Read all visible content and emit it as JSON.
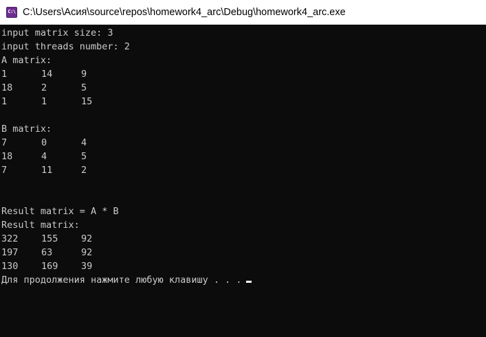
{
  "window": {
    "title": "C:\\Users\\Асия\\source\\repos\\homework4_arc\\Debug\\homework4_arc.exe",
    "icon": "C:\\"
  },
  "console": {
    "size_prompt": "input matrix size: 3",
    "threads_prompt": "input threads number: 2",
    "a_header": "A matrix:",
    "a_rows": [
      [
        "1",
        "14",
        "9"
      ],
      [
        "18",
        "2",
        "5"
      ],
      [
        "1",
        "1",
        "15"
      ]
    ],
    "b_header": "B matrix:",
    "b_rows": [
      [
        "7",
        "0",
        "4"
      ],
      [
        "18",
        "4",
        "5"
      ],
      [
        "7",
        "11",
        "2"
      ]
    ],
    "result_eq": "Result matrix = A * B",
    "result_header": "Result matrix:",
    "result_rows": [
      [
        "322",
        "155",
        "92"
      ],
      [
        "197",
        "63",
        "92"
      ],
      [
        "130",
        "169",
        "39"
      ]
    ],
    "press_key": "Для продолжения нажмите любую клавишу . . ."
  }
}
